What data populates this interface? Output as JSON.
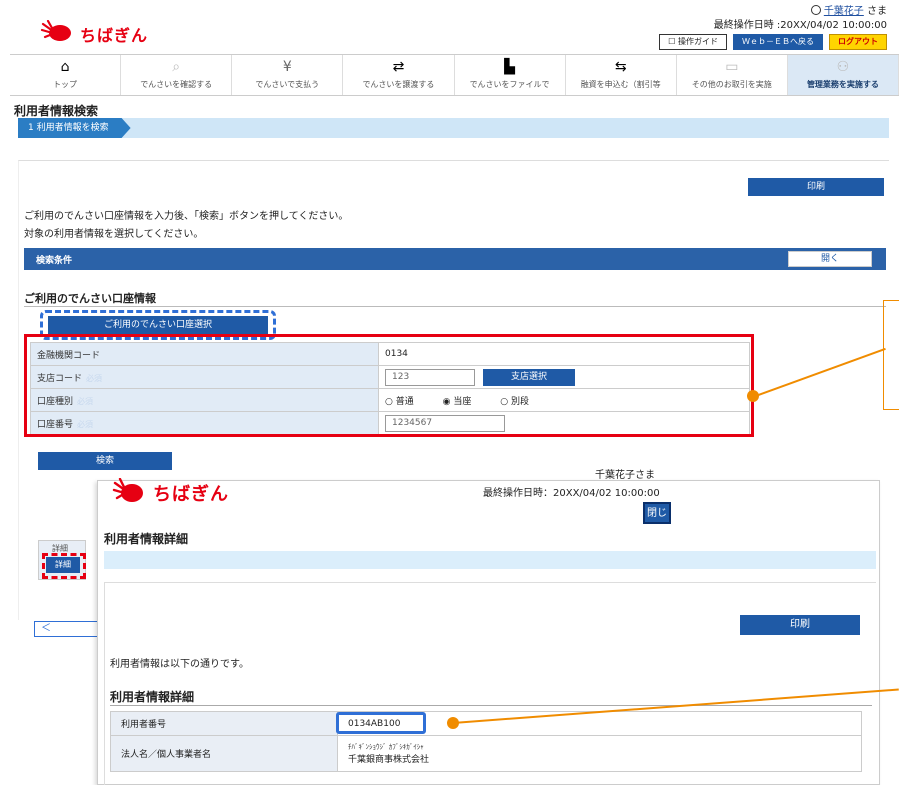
{
  "brand": {
    "name": "ちばぎん",
    "logo_color": "#e60012"
  },
  "header": {
    "user_name": "千葉花子",
    "user_suffix": " さま",
    "last_operation": "最終操作日時 :20XX/04/02 10:00:00",
    "buttons": {
      "guide": "操作ガイド",
      "web_eb": "Ｗｅｂ－ＥＢへ戻る",
      "logout": "ログアウト"
    }
  },
  "nav": [
    {
      "label": "トップ",
      "icon": "house-icon"
    },
    {
      "label": "でんさいを確認する",
      "icon": "magnifier-icon"
    },
    {
      "label": "でんさいで支払う",
      "icon": "yen-icon"
    },
    {
      "label": "でんさいを譲渡する",
      "icon": "transfer-icon"
    },
    {
      "label": "でんさいをファイルで",
      "icon": "file-icon"
    },
    {
      "label": "融資を申込む（割引等",
      "icon": "loan-icon"
    },
    {
      "label": "その他のお取引を実施",
      "icon": "other-icon"
    },
    {
      "label": "管理業務を実施する",
      "icon": "admin-icon"
    }
  ],
  "page": {
    "title": "利用者情報検索",
    "step": "1 利用者情報を検索",
    "print_label": "印刷",
    "instructions": [
      "ご利用のでんさい口座情報を入力後、「検索」ボタンを押してください。",
      "対象の利用者情報を選択してください。"
    ],
    "condition_label": "検索条件",
    "open_label": "開く",
    "section_title": "ご利用のでんさい口座情報",
    "select_account_label": "ご利用のでんさい口座選択",
    "required_tag": "必須",
    "form": {
      "bank_code_label": "金融機関コード",
      "bank_code_value": "0134",
      "branch_code_label": "支店コード",
      "branch_code_value": "123",
      "branch_select_label": "支店選択",
      "account_type_label": "口座種別",
      "account_types": [
        "普通",
        "当座",
        "別段"
      ],
      "account_type_selected": "当座",
      "account_number_label": "口座番号",
      "account_number_value": "1234567"
    },
    "search_label": "検索",
    "detail_header": "詳細",
    "detail_button": "詳細",
    "back_label": "＜"
  },
  "popup": {
    "brand": "ちばぎん",
    "user": "千葉花子さま",
    "last_operation": "最終操作日時：20XX/04/02 10:00:00",
    "close_label": "閉じる",
    "title": "利用者情報詳細",
    "print_label": "印刷",
    "message": "利用者情報は以下の通りです。",
    "section_title": "利用者情報詳細",
    "rows": {
      "user_number_label": "利用者番号",
      "user_number_value": "0134AB100",
      "corp_name_label": "法人名／個人事業者名",
      "corp_name_kana": "ﾁﾊﾞｷﾞﾝｼｮｳｼﾞ ｶﾌﾞｼｷｶﾞｲｼｬ",
      "corp_name_value": "千葉銀商事株式会社"
    }
  }
}
